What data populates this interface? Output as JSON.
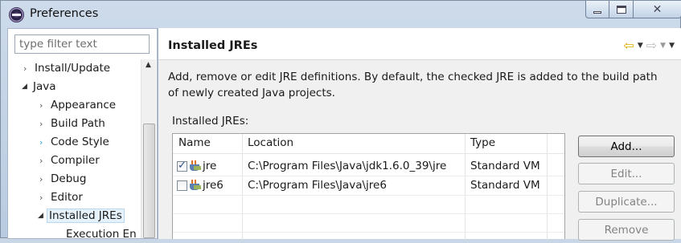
{
  "window": {
    "title": "Preferences",
    "icon": "eclipse-icon"
  },
  "sidebar": {
    "filter_placeholder": "type filter text",
    "items": [
      {
        "label": "Install/Update",
        "expander": "collapsed"
      },
      {
        "label": "Java",
        "expander": "expanded"
      },
      {
        "label": "Appearance",
        "expander": "collapsed"
      },
      {
        "label": "Build Path",
        "expander": "collapsed"
      },
      {
        "label": "Code Style",
        "expander": "collapsed-highlight"
      },
      {
        "label": "Compiler",
        "expander": "collapsed"
      },
      {
        "label": "Debug",
        "expander": "collapsed"
      },
      {
        "label": "Editor",
        "expander": "collapsed"
      },
      {
        "label": "Installed JREs",
        "expander": "expanded",
        "selected": true
      },
      {
        "label": "Execution En",
        "expander": "none"
      }
    ]
  },
  "main": {
    "title": "Installed JREs",
    "description": "Add, remove or edit JRE definitions. By default, the checked JRE is added to the build path of newly created Java projects.",
    "section_label": "Installed JREs:",
    "table": {
      "headers": [
        "Name",
        "Location",
        "Type"
      ],
      "rows": [
        {
          "checked": true,
          "name": "jre",
          "location": "C:\\Program Files\\Java\\jdk1.6.0_39\\jre",
          "type": "Standard VM"
        },
        {
          "checked": false,
          "name": "jre6",
          "location": "C:\\Program Files\\Java\\jre6",
          "type": "Standard VM"
        }
      ]
    },
    "buttons": {
      "add": "Add...",
      "edit": "Edit...",
      "duplicate": "Duplicate...",
      "remove": "Remove"
    }
  },
  "colors": {
    "titlebar": "#cddbeb",
    "selection": "#e5f1fb",
    "back_arrow": "#e1a800"
  }
}
